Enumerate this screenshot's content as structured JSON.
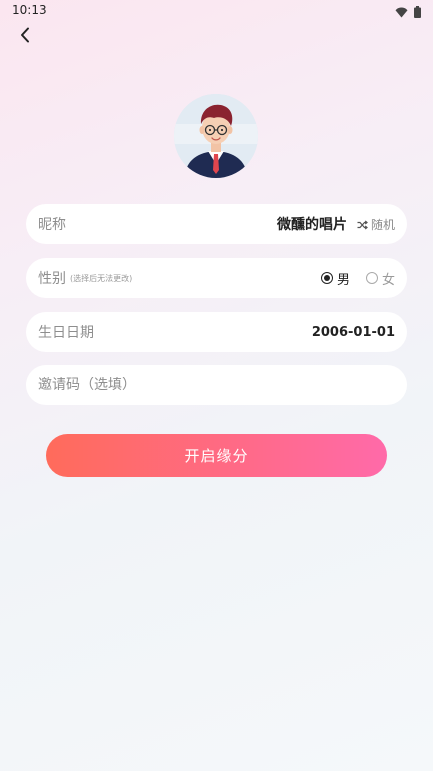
{
  "status_bar": {
    "time": "10:13",
    "icons": [
      "wifi-icon",
      "battery-icon"
    ]
  },
  "header": {
    "back_icon": "chevron-left-icon"
  },
  "profile": {
    "avatar": "avatar-man-glasses"
  },
  "nickname": {
    "label": "昵称",
    "value": "微醺的唱片",
    "random_label": "随机",
    "random_icon": "shuffle-icon"
  },
  "gender": {
    "label": "性别",
    "hint": "(选择后无法更改)",
    "options": [
      {
        "label": "男",
        "selected": true
      },
      {
        "label": "女",
        "selected": false
      }
    ]
  },
  "birthday": {
    "label": "生日日期",
    "value": "2006-01-01"
  },
  "invite_code": {
    "placeholder": "邀请码（选填）",
    "value": ""
  },
  "submit": {
    "label": "开启缘分"
  },
  "colors": {
    "button_gradient_start": "#ff6b5b",
    "button_gradient_end": "#ff6aa9",
    "field_background": "#ffffff"
  }
}
